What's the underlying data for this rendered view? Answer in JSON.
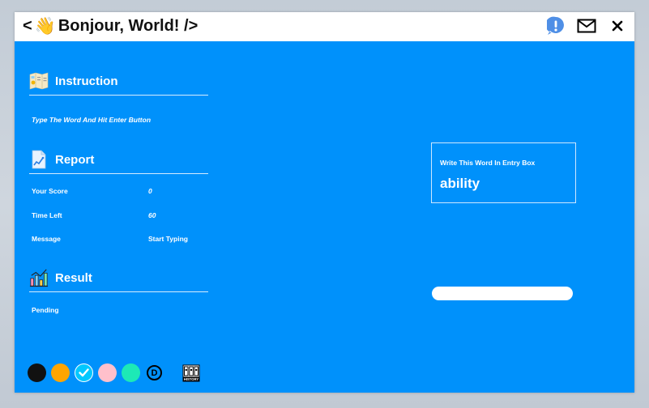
{
  "title": {
    "prefix": "<",
    "suffix": "Bonjour, World! />",
    "emoji": "👋"
  },
  "sections": {
    "instruction": {
      "label": "Instruction",
      "text": "Type The Word And Hit Enter Button"
    },
    "report": {
      "label": "Report",
      "rows": [
        {
          "key": "Your Score",
          "value": "0"
        },
        {
          "key": "Time Left",
          "value": "60"
        },
        {
          "key": "Message",
          "value": "Start Typing"
        }
      ]
    },
    "result": {
      "label": "Result",
      "status": "Pending"
    }
  },
  "word_box": {
    "hint": "Write This Word In Entry Box",
    "word": "ability"
  },
  "entry": {
    "value": "",
    "placeholder": ""
  },
  "theme_colors": [
    "#111111",
    "#ffa500",
    "#00c8ff",
    "#ffc0cb",
    "#1de9b6"
  ],
  "selected_theme_index": 2,
  "dark_mode_label": "D",
  "history_label": "HISTORY",
  "icons": [
    "info-alert-icon",
    "mail-icon",
    "close-icon",
    "map-icon",
    "report-chart-icon",
    "bar-chart-icon",
    "check-icon",
    "history-icon"
  ]
}
